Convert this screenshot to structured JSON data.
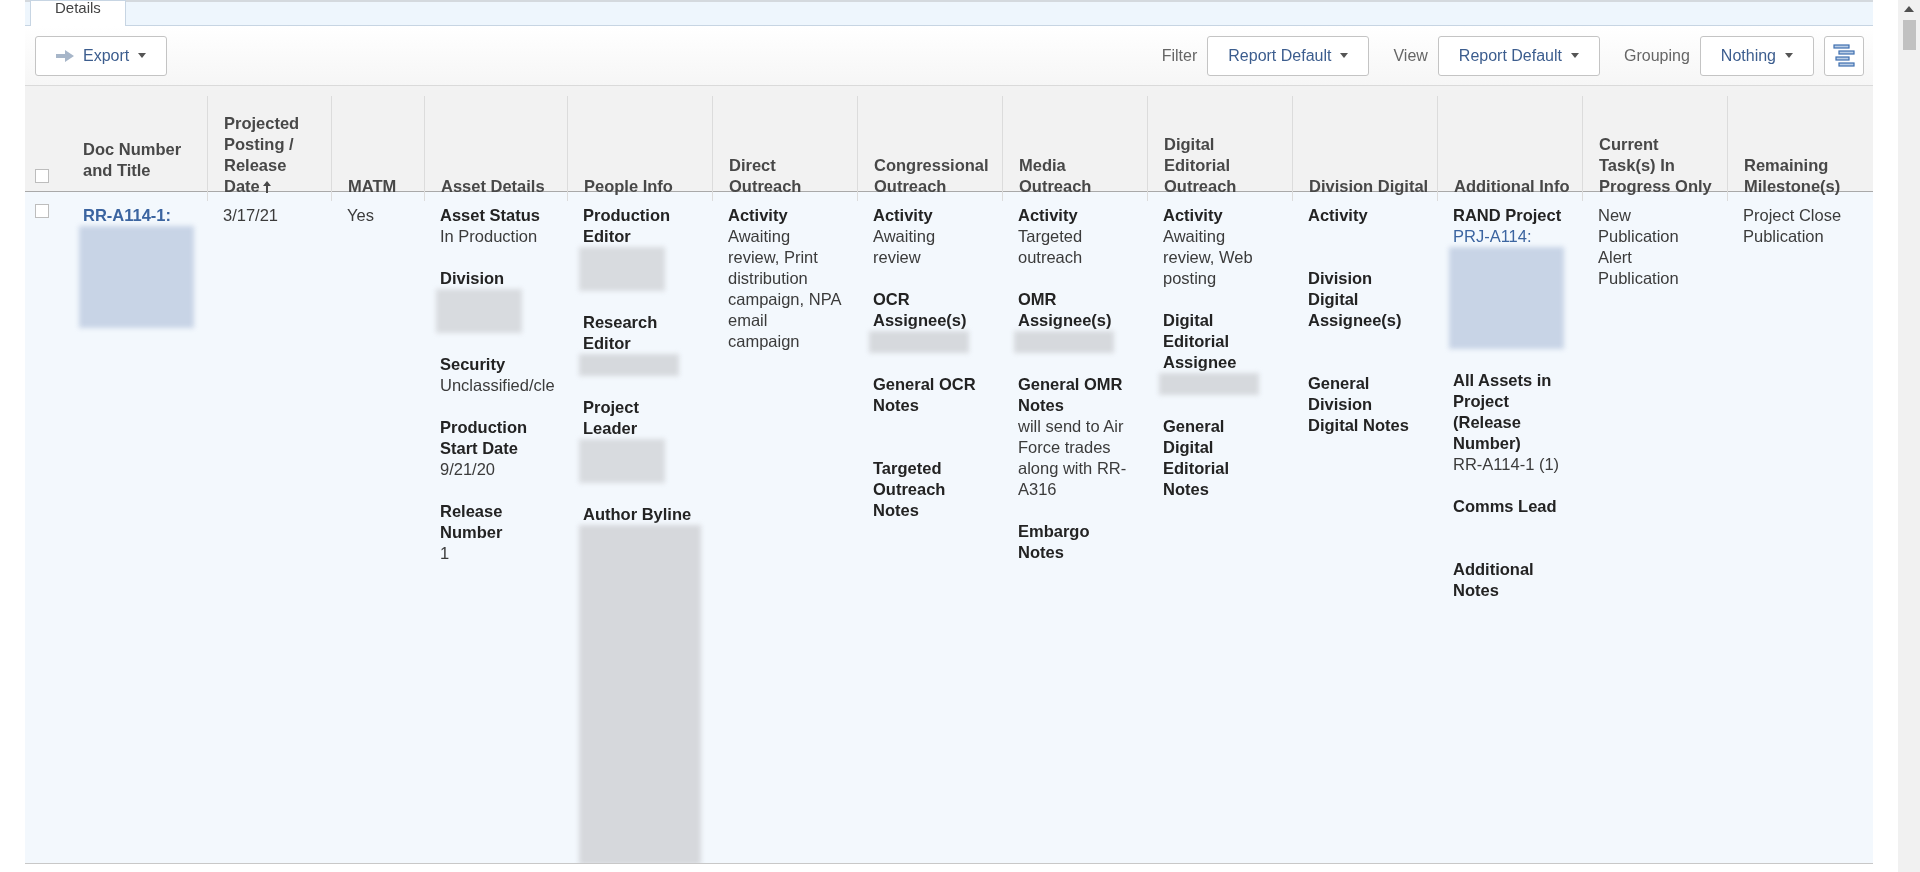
{
  "tabs": [
    {
      "label": "Details",
      "selected": true
    }
  ],
  "toolbar": {
    "export_button": "Export",
    "controls": [
      {
        "label": "Filter",
        "value": "Report Default"
      },
      {
        "label": "View",
        "value": "Report Default"
      },
      {
        "label": "Grouping",
        "value": "Nothing"
      }
    ]
  },
  "table": {
    "select_all": {
      "checked": false
    },
    "columns": [
      {
        "label": "Doc Number and Title",
        "sorted": false
      },
      {
        "label": "Projected Posting / Release Date",
        "sorted": true
      },
      {
        "label": "MATM",
        "sorted": false
      },
      {
        "label": "Asset Details",
        "sorted": false
      },
      {
        "label": "People Info",
        "sorted": false
      },
      {
        "label": "Direct Outreach",
        "sorted": false
      },
      {
        "label": "Congressional Outreach",
        "sorted": false
      },
      {
        "label": "Media Outreach",
        "sorted": false
      },
      {
        "label": "Digital Editorial Outreach",
        "sorted": false
      },
      {
        "label": "Division Digital",
        "sorted": false
      },
      {
        "label": "Additional Info",
        "sorted": false
      },
      {
        "label": "Current Task(s) In Progress Only",
        "sorted": false
      },
      {
        "label": "Remaining Milestone(s)",
        "sorted": false
      }
    ],
    "rows": [
      {
        "checked": false,
        "cells": [
          {
            "fields": [
              {
                "link": "RR-A114-1:",
                "kind": "image"
              }
            ]
          },
          {
            "fields": [
              {
                "value": "3/17/21"
              }
            ]
          },
          {
            "fields": [
              {
                "value": "Yes"
              }
            ]
          },
          {
            "fields": [
              {
                "label": "Asset Status",
                "value": "In Production"
              },
              {
                "label": "Division",
                "kind": "block"
              },
              {
                "label": "Security",
                "value": "Unclassified/cle"
              },
              {
                "label": "Production Start Date",
                "value": "9/21/20"
              },
              {
                "label": "Release Number",
                "value": "1"
              }
            ]
          },
          {
            "fields": [
              {
                "label": "Production Editor",
                "kind": "block"
              },
              {
                "label": "Research Editor",
                "kind": "line"
              },
              {
                "label": "Project Leader",
                "kind": "block"
              },
              {
                "label": "Author Byline",
                "kind": "tall"
              }
            ]
          },
          {
            "fields": [
              {
                "label": "Activity",
                "value": "Awaiting review, Print distribution campaign, NPA email campaign"
              }
            ]
          },
          {
            "fields": [
              {
                "label": "Activity",
                "value": "Awaiting review"
              },
              {
                "label": "OCR Assignee(s)",
                "kind": "line"
              },
              {
                "label": "General OCR Notes"
              },
              {
                "label": "Targeted Outreach Notes"
              }
            ]
          },
          {
            "fields": [
              {
                "label": "Activity",
                "value": "Targeted outreach"
              },
              {
                "label": "OMR Assignee(s)",
                "kind": "line"
              },
              {
                "label": "General OMR Notes",
                "value": "will send to Air Force trades along with RR-A316"
              },
              {
                "label": "Embargo Notes"
              }
            ]
          },
          {
            "fields": [
              {
                "label": "Activity",
                "value": "Awaiting review, Web posting"
              },
              {
                "label": "Digital Editorial Assignee",
                "kind": "line"
              },
              {
                "label": "General Digital Editorial Notes"
              }
            ]
          },
          {
            "fields": [
              {
                "label": "Activity"
              },
              {
                "label": "Division Digital Assignee(s)"
              },
              {
                "label": "General Division Digital Notes"
              }
            ]
          },
          {
            "fields": [
              {
                "label": "RAND Project",
                "link": "PRJ-A114:",
                "kind": "image"
              },
              {
                "label": "All Assets in Project (Release Number)",
                "value": "RR-A114-1 (1)"
              },
              {
                "label": "Comms Lead"
              },
              {
                "label": "Additional Notes"
              }
            ]
          },
          {
            "fields": [
              {
                "value": "New Publication Alert Publication"
              }
            ]
          },
          {
            "fields": [
              {
                "value": "Project Close Publication"
              }
            ]
          }
        ]
      }
    ]
  }
}
